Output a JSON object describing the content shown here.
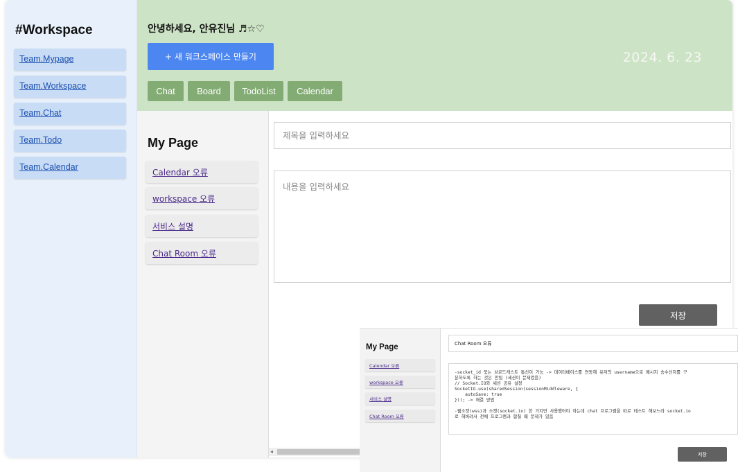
{
  "workspace_sidebar": {
    "title": "#Workspace",
    "items": [
      {
        "label": "Team.Mypage"
      },
      {
        "label": "Team.Workspace"
      },
      {
        "label": "Team.Chat"
      },
      {
        "label": "Team.Todo"
      },
      {
        "label": "Team.Calendar"
      }
    ]
  },
  "header": {
    "greeting": "안녕하세요, 안유진님 ♬☆♡",
    "new_workspace_label": "+ 새 워크스페이스 만들기",
    "date": "2024. 6. 23",
    "nav": [
      {
        "label": "Chat"
      },
      {
        "label": "Board"
      },
      {
        "label": "TodoList"
      },
      {
        "label": "Calendar"
      }
    ]
  },
  "mypage": {
    "title": "My Page",
    "items": [
      {
        "label": "Calendar 오류"
      },
      {
        "label": "workspace 오류"
      },
      {
        "label": "서비스 설명"
      },
      {
        "label": "Chat Room 오류"
      }
    ]
  },
  "editor": {
    "title_placeholder": "제목을 입력하세요",
    "title_value": "",
    "body_placeholder": "내용을 입력하세요",
    "body_value": "",
    "save_label": "저장"
  },
  "inset": {
    "title": "My Page",
    "items": [
      {
        "label": "Calendar 오류"
      },
      {
        "label": "workspace 오류"
      },
      {
        "label": "서비스 설명"
      },
      {
        "label": "Chat Room 오류"
      }
    ],
    "post_title": "Chat Room 오류",
    "post_body": "-socket_id 묶는 브로드캐스트 통신이 가능 -> 데이터베이스를 연동해 유저의 username으로 메시지 송수신자를 구\n분하도록 하는 것은 안됨 (세션이 문제였음)\n// Socket.IO와 세션 공유 설정\nSocketIO.use(sharedSession(sessionMiddleware, {\n    autoSave: true\n})); -> 해결 방법\n\n-웹소켓(wss)과 소켓(socket.io) 한 가지만 사용했어야 하는데 chat 프로그램을 따로 테스트 해보느라 socket.io\n로 해버려서 전체 프로그램과 합칠 때 문제가 있음",
    "save_label": "저장"
  }
}
